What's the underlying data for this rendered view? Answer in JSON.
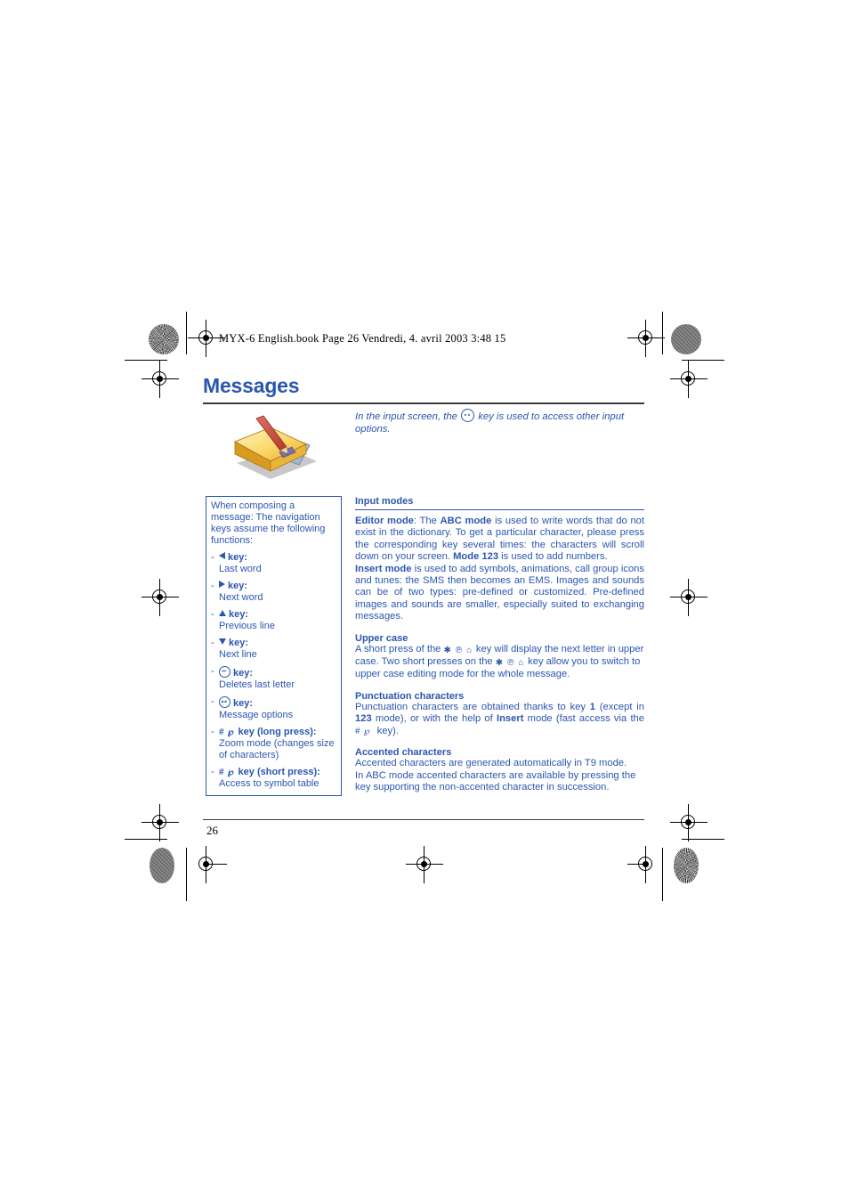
{
  "print_marks": {
    "book_tag": "MYX-6 English.book  Page 26  Vendredi, 4. avril 2003  3:48 15"
  },
  "page": {
    "title": "Messages",
    "number": "26",
    "accent_color": "#2B56B0",
    "rule_color": "#3a3a3a"
  },
  "intro": {
    "text_before": "In the input screen, the",
    "icon": "round-key-icon",
    "text_after": "key is used to access other input options."
  },
  "illustration": {
    "name": "note-pencil-envelope-illustration",
    "colors": {
      "note": "#F5C73B",
      "note_light": "#FFF2B0",
      "pencil": "#C9463A",
      "envelope": "#AFC6E8",
      "shadow": "#8A8A8A"
    }
  },
  "sidebar": {
    "lead": "When composing a message: The navigation keys assume the following functions:",
    "items": [
      {
        "icon": "arrow-left-icon",
        "head": "key:",
        "sub": "Last word"
      },
      {
        "icon": "arrow-right-icon",
        "head": "key:",
        "sub": "Next word"
      },
      {
        "icon": "arrow-up-icon",
        "head": "key:",
        "sub": "Previous line"
      },
      {
        "icon": "arrow-down-icon",
        "head": "key:",
        "sub": "Next line"
      },
      {
        "icon": "round-minus-key-icon",
        "head": "key:",
        "sub": "Deletes last letter"
      },
      {
        "icon": "round-dots-key-icon",
        "head": "key:",
        "sub": "Message options"
      },
      {
        "icon": "hash-key-icon",
        "head": "key (long press):",
        "sub": "Zoom mode (changes size of characters)"
      },
      {
        "icon": "hash-key-icon",
        "head": "key (short press):",
        "sub": "Access to symbol table"
      }
    ]
  },
  "main": {
    "sections": [
      {
        "heading": "Input modes",
        "ruled": true,
        "paragraphs": [
          {
            "runs": [
              {
                "text": "Editor mode",
                "bold": true
              },
              {
                "text": ": The ",
                "bold": false
              },
              {
                "text": "ABC mode",
                "bold": true
              },
              {
                "text": " is used to write words that do not exist in the dictionary. To get a particular character, please press the corresponding key several times: the characters will scroll down on your screen. ",
                "bold": false
              },
              {
                "text": "Mode 123",
                "bold": true
              },
              {
                "text": " is used to add numbers.",
                "bold": false
              }
            ]
          },
          {
            "runs": [
              {
                "text": "Insert mode",
                "bold": true
              },
              {
                "text": " is used to add symbols, animations, call group icons and tunes: the SMS then becomes an EMS. Images and sounds can be of two types: pre-defined or customized. Pre-defined images and sounds are smaller, especially suited to exchanging messages.",
                "bold": false
              }
            ]
          }
        ]
      },
      {
        "heading": "Upper case",
        "ruled": false,
        "paragraphs": [
          {
            "runs": [
              {
                "text": "A short press of the ",
                "bold": false
              },
              {
                "text": "star-key-icon",
                "icon": true
              },
              {
                "text": " key will display the next letter in upper case. Two short presses on the ",
                "bold": false
              },
              {
                "text": "star-key-icon",
                "icon": true
              },
              {
                "text": " key allow you to switch to upper case editing mode for the whole message.",
                "bold": false
              }
            ]
          }
        ]
      },
      {
        "heading": "Punctuation characters",
        "ruled": false,
        "paragraphs": [
          {
            "runs": [
              {
                "text": "Punctuation characters are obtained thanks to key ",
                "bold": false
              },
              {
                "text": "1",
                "bold": true
              },
              {
                "text": " (except in ",
                "bold": false
              },
              {
                "text": "123",
                "bold": true
              },
              {
                "text": " mode), or with the help of ",
                "bold": false
              },
              {
                "text": "Insert",
                "bold": true
              },
              {
                "text": " mode (fast access via the ",
                "bold": false
              },
              {
                "text": "hash-key-icon",
                "icon": true
              },
              {
                "text": " key).",
                "bold": false
              }
            ]
          }
        ]
      },
      {
        "heading": "Accented characters",
        "ruled": false,
        "paragraphs": [
          {
            "runs": [
              {
                "text": "Accented characters are generated automatically in T9 mode.",
                "bold": false
              }
            ]
          },
          {
            "runs": [
              {
                "text": "In ABC mode accented characters are available by pressing the key supporting the non-accented character in succession.",
                "bold": false
              }
            ]
          }
        ]
      }
    ]
  }
}
